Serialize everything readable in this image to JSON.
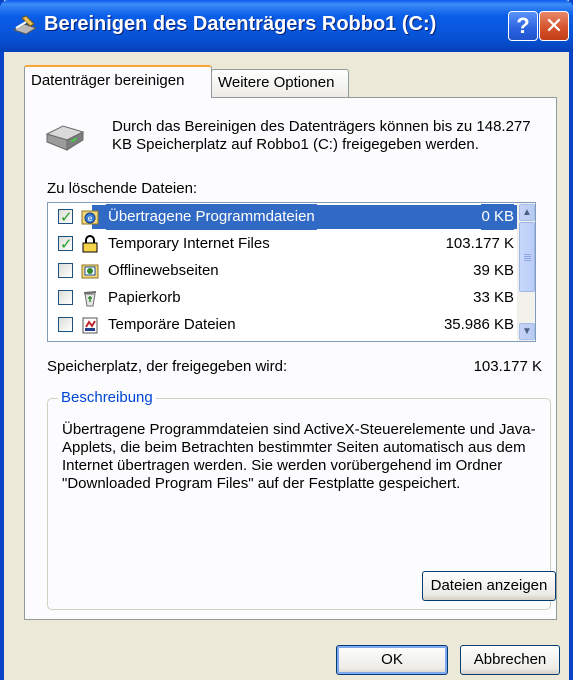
{
  "window": {
    "title": "Bereinigen des Datenträgers Robbo1 (C:)",
    "help_label": "?",
    "close_label": "✕"
  },
  "tabs": [
    {
      "label": "Datenträger bereinigen",
      "active": true
    },
    {
      "label": "Weitere Optionen",
      "active": false
    }
  ],
  "intro_text": "Durch das Bereinigen des Datenträgers können bis zu 148.277 KB Speicherplatz auf Robbo1 (C:) freigegeben werden.",
  "files_label": "Zu löschende Dateien:",
  "files": [
    {
      "name": "Übertragene Programmdateien",
      "size": "0 KB",
      "checked": true,
      "selected": true,
      "icon": "program-files-icon"
    },
    {
      "name": "Temporary Internet Files",
      "size": "103.177 K",
      "checked": true,
      "selected": false,
      "icon": "lock-folder-icon"
    },
    {
      "name": "Offlinewebseiten",
      "size": "39 KB",
      "checked": false,
      "selected": false,
      "icon": "offline-pages-icon"
    },
    {
      "name": "Papierkorb",
      "size": "33 KB",
      "checked": false,
      "selected": false,
      "icon": "recycle-bin-icon"
    },
    {
      "name": "Temporäre Dateien",
      "size": "35.986 KB",
      "checked": false,
      "selected": false,
      "icon": "temp-files-icon"
    }
  ],
  "space": {
    "label": "Speicherplatz, der freigegeben wird:",
    "value": "103.177 K"
  },
  "description": {
    "title": "Beschreibung",
    "text": "Übertragene Programmdateien sind ActiveX-Steuerelemente und Java-Applets, die beim Betrachten bestimmter Seiten automatisch aus dem Internet übertragen werden. Sie werden vorübergehend im Ordner \"Downloaded Program Files\" auf der Festplatte gespeichert."
  },
  "buttons": {
    "show_files": "Dateien anzeigen",
    "ok": "OK",
    "cancel": "Abbrechen"
  },
  "colors": {
    "titlebar": "#0753D7",
    "selection": "#316AC5",
    "group_title": "#0046D5",
    "dialog_bg": "#ECE9D8"
  }
}
